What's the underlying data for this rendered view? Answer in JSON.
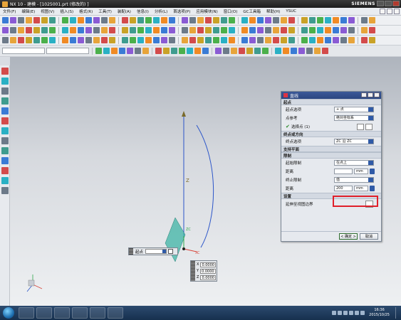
{
  "window": {
    "title": "NX 10 - 建模 - [1025001.prt (修改的) ]",
    "brand": "SIEMENS"
  },
  "menu": [
    "文件(F)",
    "编辑(E)",
    "视图(V)",
    "插入(S)",
    "格式(R)",
    "工具(T)",
    "装配(A)",
    "信息(I)",
    "分析(L)",
    "首选项(P)",
    "应用模块(N)",
    "窗口(O)",
    "GC工具箱",
    "帮助(H)",
    "YSUC"
  ],
  "dialog": {
    "title": "直线",
    "start_section": "起点",
    "start_option_label": "起点选项",
    "start_option_value": "+ 点",
    "point_ref_label": "点参考",
    "point_ref_value": "绝对坐标系",
    "select_point_label": "选择点 (1)",
    "end_section": "终点或方向",
    "end_option_label": "终点选项",
    "end_option_value": "ZC 沿 ZC",
    "support_plane_section": "支持平面",
    "limits_section": "限制",
    "start_limit_label": "起始限制",
    "start_limit_value": "在点上",
    "distance1_label": "距离",
    "distance1_value": "",
    "distance1_unit": "mm",
    "end_limit_label": "终止限制",
    "end_limit_value": "值",
    "distance2_label": "距离",
    "distance2_value": "200",
    "distance2_unit": "mm",
    "settings_section": "设置",
    "associative_label": "延伸至视图边界",
    "ok_label": "< 确定 >",
    "cancel_label": "取消"
  },
  "float_start": {
    "label": "起点"
  },
  "coords": {
    "x_label": "X",
    "x_value": "0.0000",
    "y_label": "Y",
    "y_value": "0.0000",
    "z_label": "Z",
    "z_value": "0.0000"
  },
  "viewport": {
    "axis_z_label": "Z",
    "axis_zc_label": "ZC",
    "axis_xc_label": "XC"
  },
  "taskbar": {
    "time": "16:36",
    "date": "2015/10/25"
  },
  "colors": {
    "line": "#2b55c9",
    "plane": "#3fb4a6",
    "highlight": "#e0202a",
    "accent": "#2f5aa7"
  }
}
